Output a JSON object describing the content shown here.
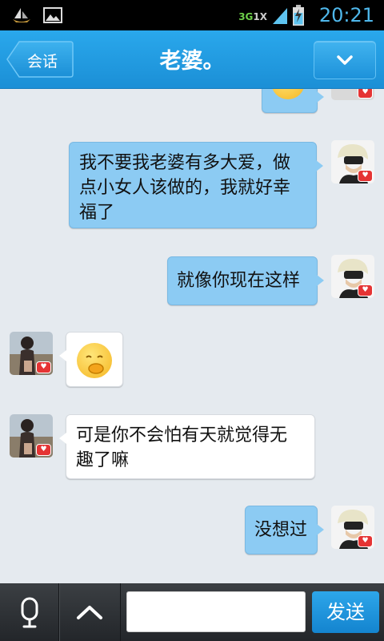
{
  "status_bar": {
    "time": "20:21",
    "network": "3G",
    "network_sub": "1X",
    "icons": [
      "boat-notification-icon",
      "image-notification-icon",
      "signal-icon",
      "battery-charging-icon"
    ]
  },
  "title_bar": {
    "back_label": "会话",
    "title": "老婆。",
    "menu_icon": "chevron-down-icon"
  },
  "messages": [
    {
      "side": "me",
      "type": "emoji-partial",
      "emoji": "😊"
    },
    {
      "side": "me",
      "type": "text",
      "text": "我不要我老婆有多大爱，做点小女人该做的，我就好幸福了"
    },
    {
      "side": "me",
      "type": "text",
      "text": "就像你现在这样"
    },
    {
      "side": "them",
      "type": "emoji",
      "emoji": "🤭"
    },
    {
      "side": "them",
      "type": "text",
      "text": "可是你不会怕有天就觉得无趣了嘛"
    },
    {
      "side": "me",
      "type": "text",
      "text": "没想过"
    }
  ],
  "message_lines": {
    "m1": [
      "我不要我老婆有多大爱，做",
      "点小女人该做的，我就好幸",
      "福了"
    ],
    "m4": [
      "可是你不会怕有天就觉得无",
      "趣了嘛"
    ]
  },
  "bottom_bar": {
    "voice_icon": "microphone-icon",
    "expand_icon": "chevron-up-icon",
    "input_value": "",
    "send_label": "发送"
  },
  "colors": {
    "header": "#1b8fd6",
    "my_bubble": "#8ccbf3",
    "their_bubble": "#ffffff",
    "chat_bg": "#e5eaef",
    "send_button": "#1484cf"
  }
}
